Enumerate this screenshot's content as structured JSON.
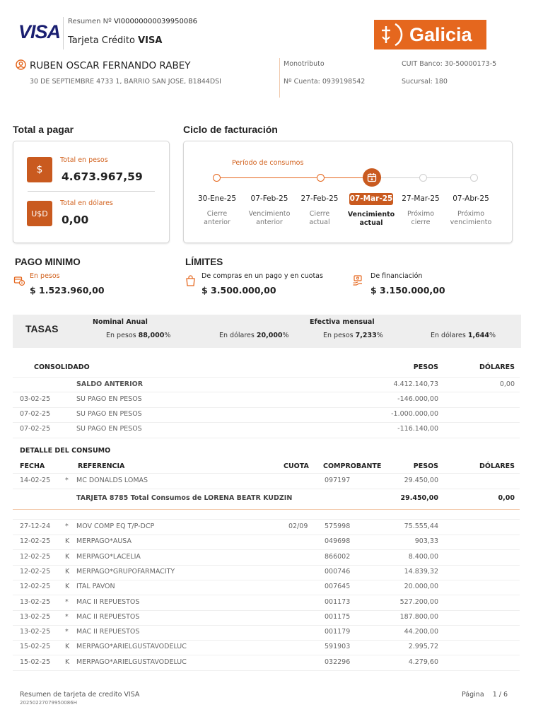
{
  "header": {
    "visa_logo": "VISA",
    "resumen_label": "Resumen Nº",
    "resumen_number": "VI00000000039950086",
    "card_label": "Tarjeta Crédito",
    "card_brand": "VISA",
    "bank_logo": "Galicia",
    "holder_name": "RUBEN OSCAR FERNANDO RABEY",
    "holder_address": "30 DE SEPTIEMBRE 4733 1, BARRIO SAN JOSE, B1844DSI",
    "tax_condition": "Monotributo",
    "account": "Nº Cuenta: 0939198542",
    "cuit": "CUIT Banco: 30-50000173-5",
    "branch": "Sucursal: 180"
  },
  "total": {
    "title": "Total a pagar",
    "pesos_label": "Total en pesos",
    "pesos_icon": "$",
    "pesos_amount": "4.673.967,59",
    "usd_label": "Total en dólares",
    "usd_icon": "U$D",
    "usd_amount": "0,00"
  },
  "ciclo": {
    "title": "Ciclo de facturación",
    "period_label": "Período de consumos",
    "steps": [
      {
        "date": "30-Ene-25",
        "label1": "Cierre",
        "label2": "anterior"
      },
      {
        "date": "07-Feb-25",
        "label1": "Vencimiento",
        "label2": "anterior"
      },
      {
        "date": "27-Feb-25",
        "label1": "Cierre",
        "label2": "actual"
      },
      {
        "date": "07-Mar-25",
        "label1": "Vencimiento",
        "label2": "actual"
      },
      {
        "date": "27-Mar-25",
        "label1": "Próximo",
        "label2": "cierre"
      },
      {
        "date": "07-Abr-25",
        "label1": "Próximo",
        "label2": "vencimiento"
      }
    ]
  },
  "pago_minimo": {
    "title": "PAGO MINIMO",
    "label": "En pesos",
    "amount": "$ 1.523.960,00"
  },
  "limites": {
    "title": "LÍMITES",
    "compras_label": "De compras en un pago y en cuotas",
    "compras_amount": "$ 3.500.000,00",
    "financiacion_label": "De financiación",
    "financiacion_amount": "$ 3.150.000,00"
  },
  "tasas": {
    "title": "TASAS",
    "nominal_header": "Nominal Anual",
    "efectiva_header": "Efectiva mensual",
    "nominal_pesos_label": "En pesos",
    "nominal_pesos": "88,000",
    "nominal_usd_label": "En dólares",
    "nominal_usd": "20,000",
    "efectiva_pesos_label": "En pesos",
    "efectiva_pesos": "7,233",
    "efectiva_usd_label": "En dólares",
    "efectiva_usd": "1,644",
    "percent": "%"
  },
  "consolidado": {
    "header": "CONSOLIDADO",
    "col_pesos": "PESOS",
    "col_dolares": "DÓLARES",
    "saldo_label": "SALDO ANTERIOR",
    "saldo_pesos": "4.412.140,73",
    "saldo_dolares": "0,00",
    "rows": [
      {
        "date": "03-02-25",
        "ref": "SU PAGO EN PESOS",
        "pesos": "-146.000,00"
      },
      {
        "date": "07-02-25",
        "ref": "SU PAGO EN PESOS",
        "pesos": "-1.000.000,00"
      },
      {
        "date": "07-02-25",
        "ref": "SU PAGO EN PESOS",
        "pesos": "-116.140,00"
      }
    ]
  },
  "detalle": {
    "title": "DETALLE DEL CONSUMO",
    "col_fecha": "FECHA",
    "col_referencia": "REFERENCIA",
    "col_cuota": "CUOTA",
    "col_comprobante": "COMPROBANTE",
    "col_pesos": "PESOS",
    "col_dolares": "DÓLARES",
    "first": {
      "date": "14-02-25",
      "flag": "*",
      "ref": "MC DONALDS LOMAS",
      "comp": "097197",
      "pesos": "29.450,00"
    },
    "subtotal_label": "TARJETA 8785 Total Consumos de LORENA BEATR KUDZIN",
    "subtotal_pesos": "29.450,00",
    "subtotal_dolares": "0,00",
    "rows": [
      {
        "date": "27-12-24",
        "flag": "*",
        "ref": "MOV COMP EQ T/P-DCP",
        "cuota": "02/09",
        "comp": "575998",
        "pesos": "75.555,44"
      },
      {
        "date": "12-02-25",
        "flag": "K",
        "ref": "MERPAGO*AUSA",
        "cuota": "",
        "comp": "049698",
        "pesos": "903,33"
      },
      {
        "date": "12-02-25",
        "flag": "K",
        "ref": "MERPAGO*LACELIA",
        "cuota": "",
        "comp": "866002",
        "pesos": "8.400,00"
      },
      {
        "date": "12-02-25",
        "flag": "K",
        "ref": "MERPAGO*GRUPOFARMACITY",
        "cuota": "",
        "comp": "000746",
        "pesos": "14.839,32"
      },
      {
        "date": "12-02-25",
        "flag": "K",
        "ref": "ITAL PAVON",
        "cuota": "",
        "comp": "007645",
        "pesos": "20.000,00"
      },
      {
        "date": "13-02-25",
        "flag": "*",
        "ref": "MAC II REPUESTOS",
        "cuota": "",
        "comp": "001173",
        "pesos": "527.200,00"
      },
      {
        "date": "13-02-25",
        "flag": "*",
        "ref": "MAC II REPUESTOS",
        "cuota": "",
        "comp": "001175",
        "pesos": "187.800,00"
      },
      {
        "date": "13-02-25",
        "flag": "*",
        "ref": "MAC II REPUESTOS",
        "cuota": "",
        "comp": "001179",
        "pesos": "44.200,00"
      },
      {
        "date": "15-02-25",
        "flag": "K",
        "ref": "MERPAGO*ARIELGUSTAVODELUC",
        "cuota": "",
        "comp": "591903",
        "pesos": "2.995,72"
      },
      {
        "date": "15-02-25",
        "flag": "K",
        "ref": "MERPAGO*ARIELGUSTAVODELUC",
        "cuota": "",
        "comp": "032296",
        "pesos": "4.279,60"
      }
    ]
  },
  "footer": {
    "text": "Resumen de tarjeta de credito VISA",
    "code": "20250227079950086H",
    "page_label": "Página",
    "page": "1 / 6"
  },
  "colors": {
    "accent": "#e5671e",
    "accent_dark": "#c95a1f",
    "visa_blue": "#1a1f71"
  }
}
